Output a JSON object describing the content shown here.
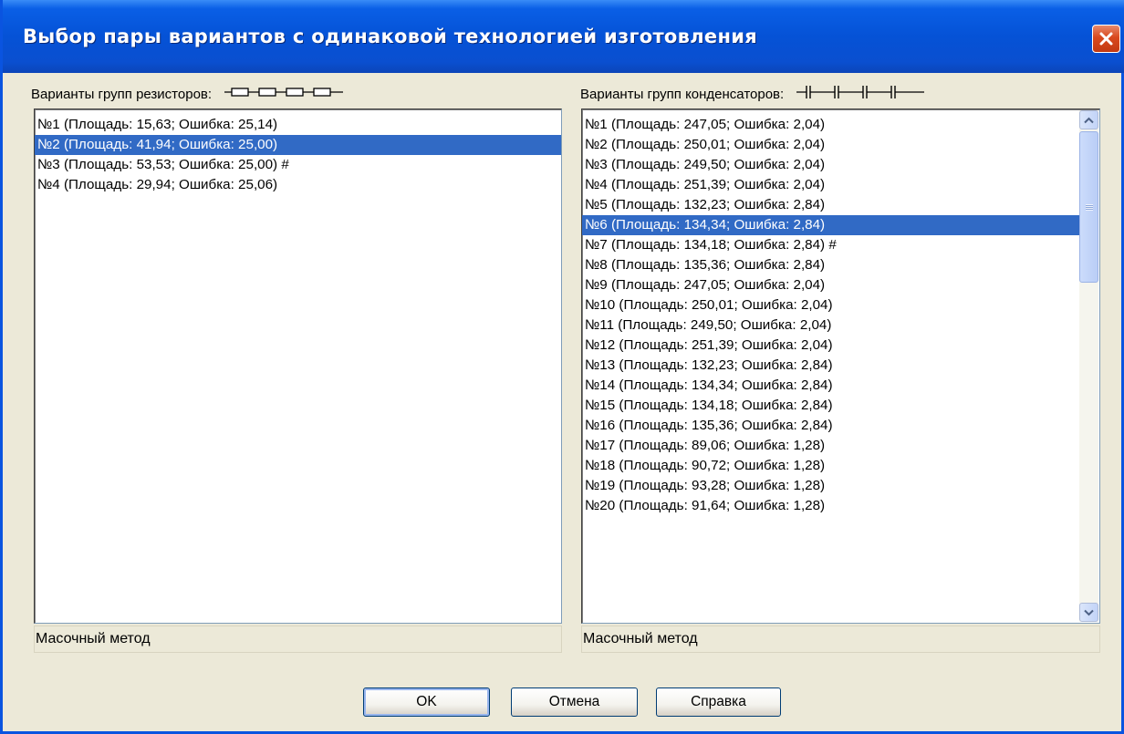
{
  "window": {
    "title": "Выбор пары вариантов с одинаковой технологией изготовления",
    "close_icon": "close-icon"
  },
  "resistors": {
    "label": "Варианты групп резисторов:",
    "symbol_icon": "resistor-chain-icon",
    "items": [
      "№1 (Площадь: 15,63; Ошибка: 25,14)",
      "№2 (Площадь: 41,94; Ошибка: 25,00)",
      "№3 (Площадь: 53,53; Ошибка: 25,00) #",
      "№4 (Площадь: 29,94; Ошибка: 25,06)"
    ],
    "selected_index": 1,
    "status": "Масочный метод"
  },
  "capacitors": {
    "label": "Варианты групп конденсаторов:",
    "symbol_icon": "capacitor-chain-icon",
    "items": [
      "№1 (Площадь: 247,05; Ошибка: 2,04)",
      "№2 (Площадь: 250,01; Ошибка: 2,04)",
      "№3 (Площадь: 249,50; Ошибка: 2,04)",
      "№4 (Площадь: 251,39; Ошибка: 2,04)",
      "№5 (Площадь: 132,23; Ошибка: 2,84)",
      "№6 (Площадь: 134,34; Ошибка: 2,84)",
      "№7 (Площадь: 134,18; Ошибка: 2,84) #",
      "№8 (Площадь: 135,36; Ошибка: 2,84)",
      "№9 (Площадь: 247,05; Ошибка: 2,04)",
      "№10 (Площадь: 250,01; Ошибка: 2,04)",
      "№11 (Площадь: 249,50; Ошибка: 2,04)",
      "№12 (Площадь: 251,39; Ошибка: 2,04)",
      "№13 (Площадь: 132,23; Ошибка: 2,84)",
      "№14 (Площадь: 134,34; Ошибка: 2,84)",
      "№15 (Площадь: 134,18; Ошибка: 2,84)",
      "№16 (Площадь: 135,36; Ошибка: 2,84)",
      "№17 (Площадь: 89,06; Ошибка: 1,28)",
      "№18 (Площадь: 90,72; Ошибка: 1,28)",
      "№19 (Площадь: 93,28; Ошибка: 1,28)",
      "№20 (Площадь: 91,64; Ошибка: 1,28)"
    ],
    "selected_index": 5,
    "status": "Масочный метод"
  },
  "buttons": {
    "ok": "OK",
    "cancel": "Отмена",
    "help": "Справка"
  },
  "colors": {
    "titlebar": "#0552d6",
    "selection": "#316ac5",
    "dialog_bg": "#ece9d8"
  }
}
